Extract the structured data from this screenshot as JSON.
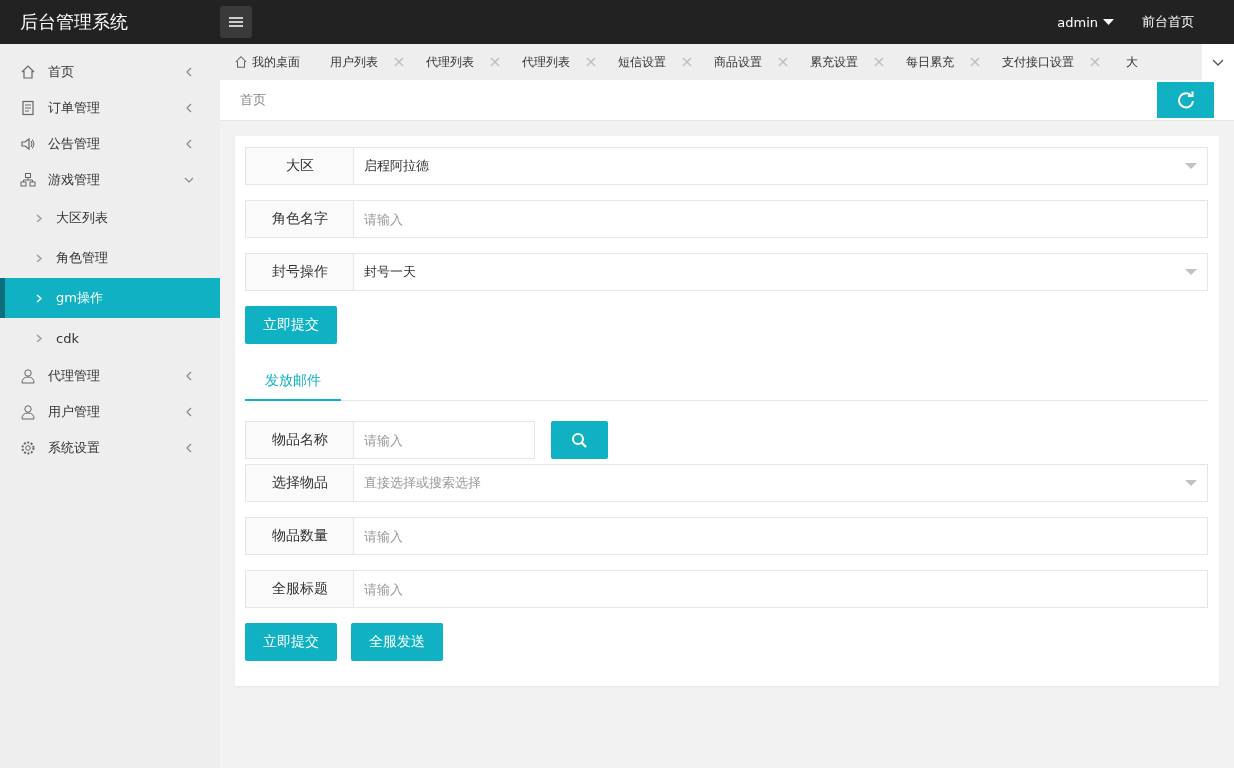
{
  "header": {
    "title": "后台管理系统",
    "user": "admin",
    "front_link": "前台首页"
  },
  "sidebar": {
    "items": [
      {
        "label": "首页",
        "expanded": false
      },
      {
        "label": "订单管理",
        "expanded": false
      },
      {
        "label": "公告管理",
        "expanded": false
      },
      {
        "label": "游戏管理",
        "expanded": true,
        "children": [
          {
            "label": "大区列表",
            "selected": false
          },
          {
            "label": "角色管理",
            "selected": false
          },
          {
            "label": "gm操作",
            "selected": true
          },
          {
            "label": "cdk",
            "selected": false
          }
        ]
      },
      {
        "label": "代理管理",
        "expanded": false
      },
      {
        "label": "用户管理",
        "expanded": false
      },
      {
        "label": "系统设置",
        "expanded": false
      }
    ]
  },
  "tabs": [
    {
      "label": "我的桌面",
      "kind": "home"
    },
    {
      "label": "用户列表",
      "kind": "closable"
    },
    {
      "label": "代理列表",
      "kind": "closable"
    },
    {
      "label": "代理列表",
      "kind": "closable"
    },
    {
      "label": "短信设置",
      "kind": "closable"
    },
    {
      "label": "商品设置",
      "kind": "closable"
    },
    {
      "label": "累充设置",
      "kind": "closable"
    },
    {
      "label": "每日累充",
      "kind": "closable"
    },
    {
      "label": "支付接口设置",
      "kind": "closable"
    },
    {
      "label": "大",
      "kind": "cut"
    }
  ],
  "breadcrumb": "首页",
  "ban_form": {
    "fields": [
      {
        "label": "大区",
        "kind": "select",
        "value": "启程阿拉德"
      },
      {
        "label": "角色名字",
        "kind": "input",
        "placeholder": "请输入"
      },
      {
        "label": "封号操作",
        "kind": "select",
        "value": "封号一天"
      }
    ],
    "buttons": [
      "立即提交"
    ]
  },
  "mail_tabs": [
    {
      "label": "发放邮件",
      "selected": true
    }
  ],
  "mail_form": {
    "fields": [
      {
        "label": "物品名称",
        "kind": "search",
        "placeholder": "请输入"
      },
      {
        "label": "选择物品",
        "kind": "select",
        "placeholder": "直接选择或搜索选择"
      },
      {
        "label": "物品数量",
        "kind": "input",
        "placeholder": "请输入"
      },
      {
        "label": "全服标题",
        "kind": "input",
        "placeholder": "请输入"
      }
    ],
    "buttons": [
      "立即提交",
      "全服发送"
    ]
  }
}
